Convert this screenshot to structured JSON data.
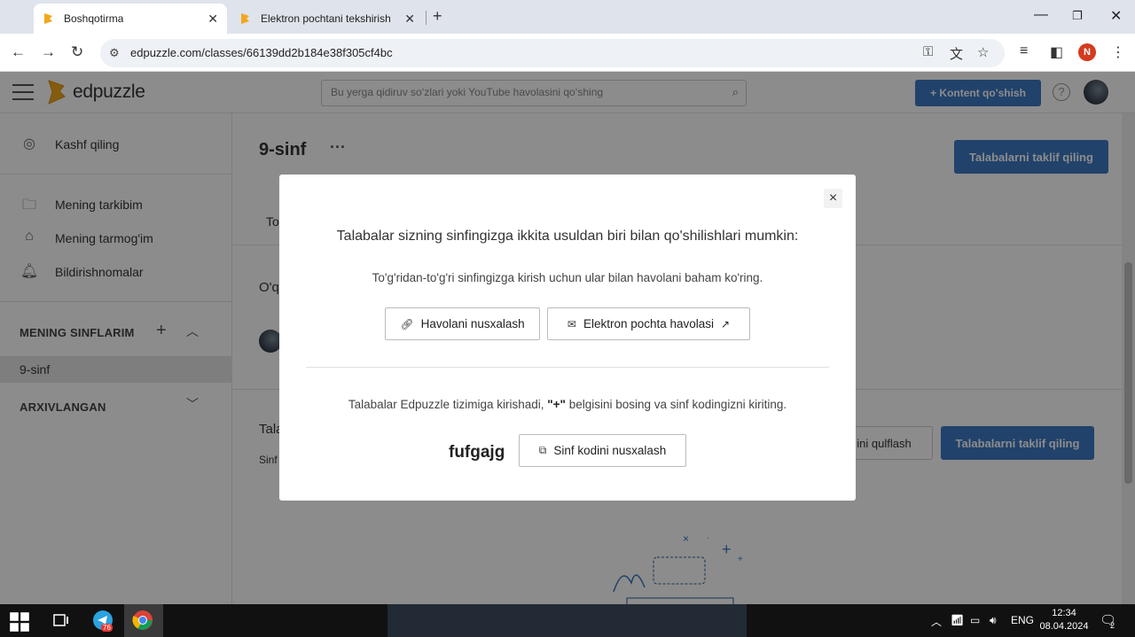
{
  "browser": {
    "tabs": [
      {
        "title": "Boshqotirma",
        "active": true
      },
      {
        "title": "Elektron pochtani tekshirish - E",
        "active": false
      }
    ],
    "url": "edpuzzle.com/classes/66139dd2b184e38f305cf4bc",
    "profile_initial": "N"
  },
  "header": {
    "logo_text": "edpuzzle",
    "search_placeholder": "Bu yerga qidiruv so‘zlari yoki YouTube havolasini qo‘shing",
    "add_content_label": "+ Kontent qo'shish",
    "help_label": "?"
  },
  "sidebar": {
    "explore": "Kashf qiling",
    "my_content": "Mening tarkibim",
    "my_network": "Mening tarmog'im",
    "notifications": "Bildirishnomalar",
    "my_classes": "MENING SINFLARIM",
    "class_item": "9-sinf",
    "archived": "ARXIVLANGAN"
  },
  "main": {
    "class_title": "9-sinf",
    "more": "···",
    "invite_label": "Talabalarni taklif qiling",
    "frag_tab": "To",
    "frag_section": "O'q",
    "frag_students": "Tala",
    "frag_sinf": "Sinf",
    "lock_label": "ini qulflash",
    "invite_label_2": "Talabalarni taklif qiling"
  },
  "modal": {
    "close": "×",
    "heading": "Talabalar sizning sinfingizga ikkita usuldan biri bilan qo'shilishlari mumkin:",
    "share_text": "To'g'ridan-to'g'ri sinfingizga kirish uchun ular bilan havolani baham ko'ring.",
    "copy_link": "Havolani nusxalash",
    "email_link": "Elektron pochta havolasi",
    "instr_before": "Talabalar Edpuzzle tizimiga kirishadi, ",
    "instr_plus": "\"+\"",
    "instr_after": " belgisini bosing va sinf kodingizni kiriting.",
    "class_code": "fufgajg",
    "copy_code": "Sinf kodini nusxalash"
  },
  "taskbar": {
    "telegram_badge": "76",
    "lang": "ENG",
    "time": "12:34",
    "date": "08.04.2024",
    "notif_count": "2"
  },
  "colors": {
    "brand_blue": "#3c78c3",
    "overlay": "rgba(0,0,0,0.45)"
  }
}
